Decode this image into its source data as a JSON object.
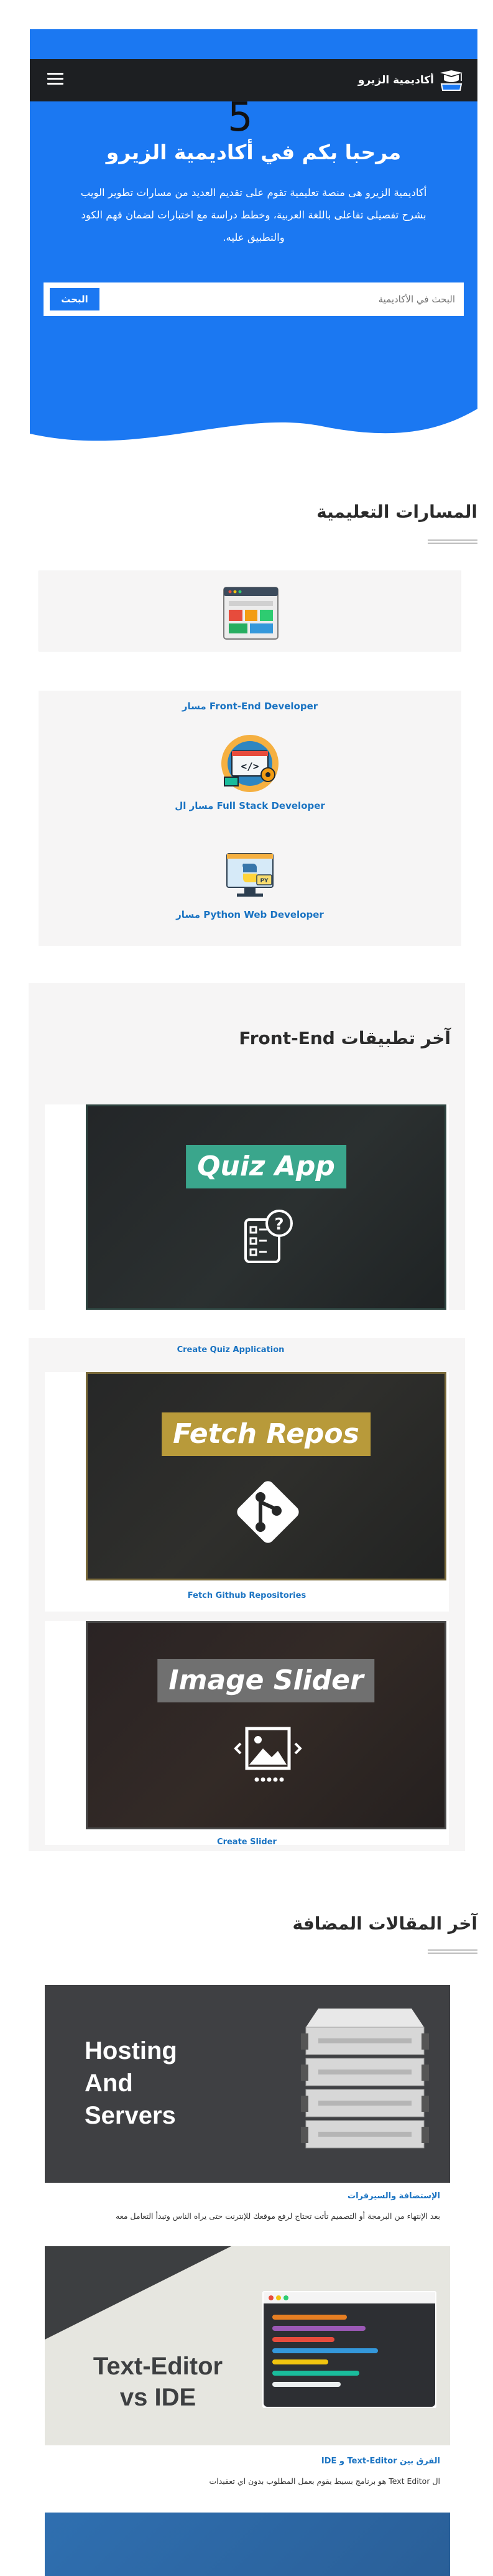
{
  "header": {
    "brand": "أكاديمية الزيرو",
    "overlay_number": "5"
  },
  "hero": {
    "title": "مرحبا بكم في أكاديمية الزيرو",
    "desc_line1": "أكاديمية الزيرو هى منصة تعليمية تقوم على تقديم العديد من مسارات تطوير الويب",
    "desc_line2": "بشرح تفصيلى تفاعلى باللغة العربية، وخطط دراسة مع اختبارات لضمان فهم الكود",
    "desc_line3": "والتطبيق عليه.",
    "search_placeholder": "البحث في الأكاديمية",
    "search_button": "البحث"
  },
  "paths": {
    "title": "المسارات التعليمية",
    "items": [
      {
        "label": "مسار Front-End Developer",
        "icon": "browser-layout-icon"
      },
      {
        "label": "مسار ال Full Stack Developer",
        "icon": "fullstack-code-icon"
      },
      {
        "label": "مسار Python Web Developer",
        "icon": "python-monitor-icon"
      }
    ]
  },
  "apps": {
    "title": "آخر تطبيقات Front-End",
    "items": [
      {
        "banner": "Quiz App",
        "caption": "Create Quiz Application",
        "icon": "quiz-icon",
        "accent": "#3aa68c"
      },
      {
        "banner": "Fetch Repos",
        "caption": "Fetch Github Repositories",
        "icon": "git-icon",
        "accent": "#b89a3a"
      },
      {
        "banner": "Image Slider",
        "caption": "Create Slider",
        "icon": "image-slider-icon",
        "accent": "#707070"
      }
    ]
  },
  "articles": {
    "title": "آخر المقالات المضافة",
    "items": [
      {
        "image_line1": "Hosting",
        "image_line2": "And",
        "image_line3": "Servers",
        "category": "الإستضافة والسيرفرات",
        "excerpt": "بعد الإنتهاء من البرمجة أو التصميم تأتت تحتاج لرفع موقعك للإنترنت حتى يراه الناس وتبدأ التعامل معه"
      },
      {
        "image_line1": "Text-Editor",
        "image_line2": "vs IDE",
        "category": "الفرق بين Text-Editor و IDE",
        "excerpt": "ال Text Editor هو برنامج بسيط يقوم بعمل المطلوب بدون اي تعقيدات"
      }
    ]
  },
  "colors": {
    "primary": "#1b78f2",
    "navbar": "#1d1f22",
    "link": "#1a73c2"
  }
}
